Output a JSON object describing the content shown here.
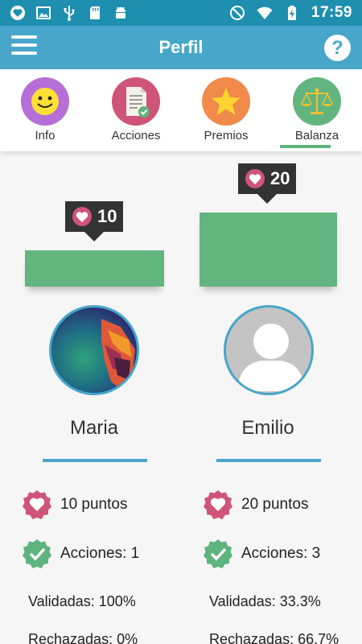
{
  "status_bar": {
    "time": "17:59",
    "left_icons": [
      "app-notification-icon",
      "image-icon",
      "usb-icon",
      "sd-card-icon",
      "android-icon"
    ],
    "right_icons": [
      "do-not-disturb-icon",
      "wifi-icon",
      "battery-charging-icon"
    ]
  },
  "app_bar": {
    "title": "Perfil",
    "menu_icon": "hamburger-menu-icon",
    "help_label": "?"
  },
  "tabs": [
    {
      "label": "Info",
      "icon": "smiley-icon",
      "color": "#b56fd6"
    },
    {
      "label": "Acciones",
      "icon": "document-check-icon",
      "color": "#cf5479"
    },
    {
      "label": "Premios",
      "icon": "star-icon",
      "color": "#f08a4b"
    },
    {
      "label": "Balanza",
      "icon": "balance-scale-icon",
      "color": "#63b57f",
      "active": true
    }
  ],
  "colors": {
    "status_bar": "#1f8fb0",
    "app_bar": "#47a6c9",
    "bar_green": "#63b57f",
    "heart_pink": "#cf5479",
    "check_green": "#5fb37c"
  },
  "users": [
    {
      "name": "Maria",
      "points_badge": "10",
      "points_text": "10 puntos",
      "acciones_text": "Acciones: 1",
      "validadas_text": "Validadas: 100%",
      "rechazadas_text": "Rechazadas: 0%"
    },
    {
      "name": "Emilio",
      "points_badge": "20",
      "points_text": "20 puntos",
      "acciones_text": "Acciones: 3",
      "validadas_text": "Validadas: 33.3%",
      "rechazadas_text": "Rechazadas: 66.7%"
    }
  ]
}
